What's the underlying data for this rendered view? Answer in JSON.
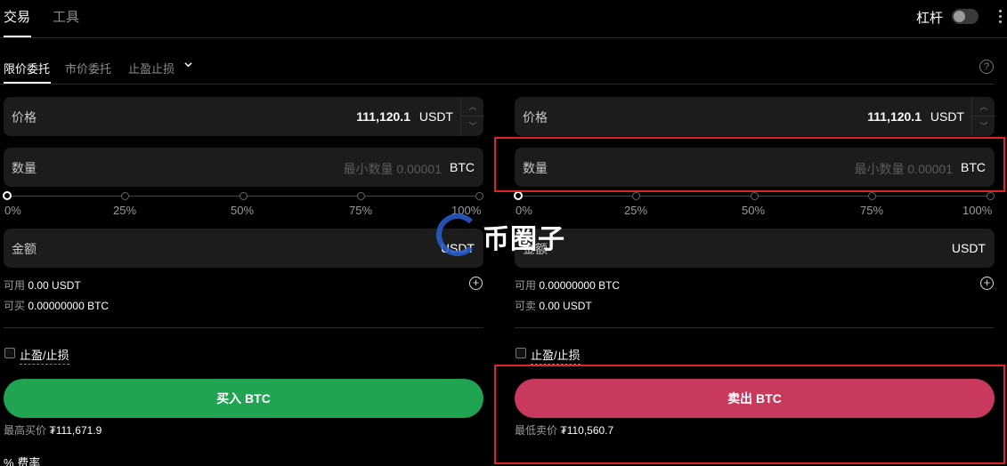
{
  "top_tabs": {
    "trade": "交易",
    "tools": "工具"
  },
  "leverage": {
    "label": "杠杆"
  },
  "order_tabs": {
    "limit": "限价委托",
    "market": "市价委托",
    "tpsl": "止盈止损"
  },
  "help_icon_glyph": "?",
  "buy": {
    "price_label": "价格",
    "price_value": "111,120.1",
    "price_unit": "USDT",
    "qty_label": "数量",
    "qty_placeholder": "最小数量 0.00001",
    "qty_unit": "BTC",
    "ticks": [
      "0%",
      "25%",
      "50%",
      "75%",
      "100%"
    ],
    "amount_label": "金额",
    "amount_unit": "USDT",
    "avail_label": "可用",
    "avail_value": "0.00 USDT",
    "can_label": "可买",
    "can_value": "0.00000000 BTC",
    "tpsl_label": "止盈/止损",
    "button": "买入 BTC",
    "best_label": "最高买价",
    "best_value": "₮111,671.9"
  },
  "sell": {
    "price_label": "价格",
    "price_value": "111,120.1",
    "price_unit": "USDT",
    "qty_label": "数量",
    "qty_placeholder": "最小数量 0.00001",
    "qty_unit": "BTC",
    "ticks": [
      "0%",
      "25%",
      "50%",
      "75%",
      "100%"
    ],
    "amount_label": "金额",
    "amount_unit": "USDT",
    "avail_label": "可用",
    "avail_value": "0.00000000 BTC",
    "can_label": "可卖",
    "can_value": "0.00 USDT",
    "tpsl_label": "止盈/止损",
    "button": "卖出 BTC",
    "best_label": "最低卖价",
    "best_value": "₮110,560.7"
  },
  "fee": {
    "icon": "%",
    "label": "费率"
  },
  "watermark": {
    "text": "币圈子"
  },
  "colors": {
    "buy": "#21a452",
    "sell": "#c9395e",
    "annotation": "#e0232a"
  }
}
